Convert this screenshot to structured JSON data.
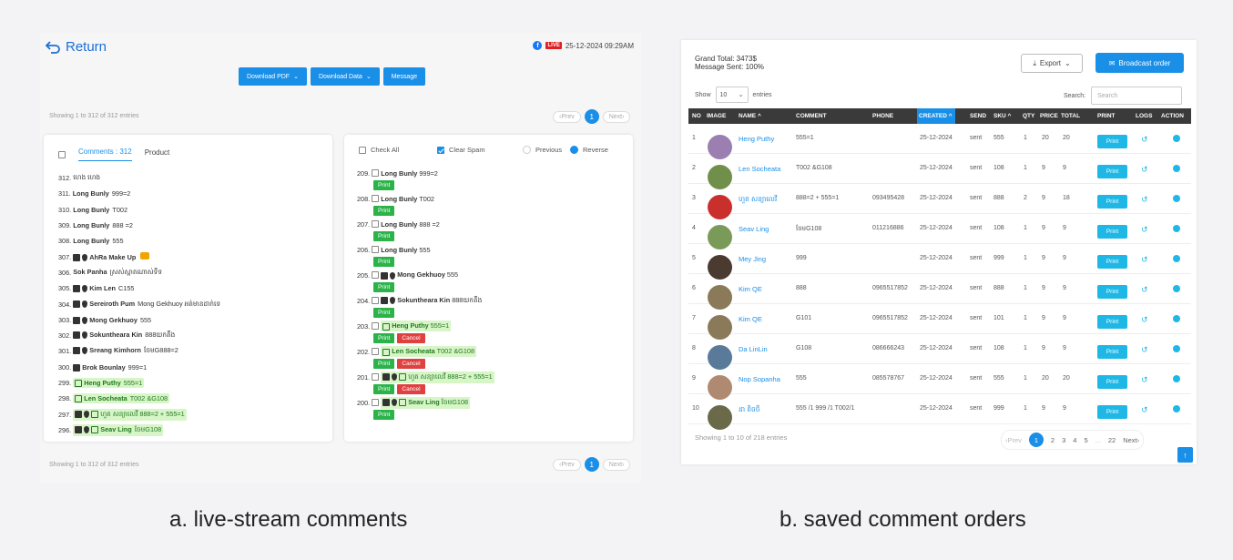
{
  "left": {
    "return_label": "Return",
    "live_badge": "LIVE",
    "timestamp": "25-12-2024 09:29AM",
    "buttons": {
      "pdf": "Download PDF",
      "data": "Download Data",
      "message": "Message"
    },
    "showing_top": "Showing 1 to 312 of 312 entries",
    "showing_bottom": "Showing 1 to 312 of 312 entries",
    "pager": {
      "prev": "‹Prev",
      "current": "1",
      "next": "Next›"
    },
    "tabs": {
      "comments": "Comments : 312",
      "product": "Product"
    },
    "comments": [
      {
        "num": "312.",
        "name": "",
        "text": "ហេង ហេង",
        "icons": [],
        "hl": false
      },
      {
        "num": "311.",
        "name": "Long Bunly",
        "text": "999=2",
        "icons": [],
        "hl": false
      },
      {
        "num": "310.",
        "name": "Long Bunly",
        "text": "T002",
        "icons": [],
        "hl": false
      },
      {
        "num": "309.",
        "name": "Long Bunly",
        "text": "888 =2",
        "icons": [],
        "hl": false
      },
      {
        "num": "308.",
        "name": "Long Bunly",
        "text": "555",
        "icons": [],
        "hl": false
      },
      {
        "num": "307.",
        "name": "AhRa Make Up",
        "text": "",
        "icons": [
          "msg",
          "pin"
        ],
        "hl": false,
        "emoji": true
      },
      {
        "num": "306.",
        "name": "Sok Panha",
        "text": "ស្រស់ស្អាតណាស់ទីទ",
        "icons": [],
        "hl": false
      },
      {
        "num": "305.",
        "name": "Kim Len",
        "text": "C155",
        "icons": [
          "msg",
          "pin"
        ],
        "hl": false
      },
      {
        "num": "304.",
        "name": "Sereiroth Pum",
        "text": "Mong Gekhuoy អត់មានដាក់ទេ",
        "icons": [
          "msg",
          "pin"
        ],
        "hl": false
      },
      {
        "num": "303.",
        "name": "Mong Gekhuoy",
        "text": "555",
        "icons": [
          "msg",
          "pin"
        ],
        "hl": false
      },
      {
        "num": "302.",
        "name": "Sokuntheara Kin",
        "text": "888យកតឹង",
        "icons": [
          "msg",
          "pin"
        ],
        "hl": false
      },
      {
        "num": "301.",
        "name": "Sreang Kimhorn",
        "text": "ចែមG888=2",
        "icons": [
          "msg",
          "pin"
        ],
        "hl": false
      },
      {
        "num": "300.",
        "name": "Brok Bounlay",
        "text": "999=1",
        "icons": [
          "msg"
        ],
        "hl": false
      },
      {
        "num": "299.",
        "name": "Heng Puthy",
        "text": "555=1",
        "icons": [
          "mail"
        ],
        "hl": true
      },
      {
        "num": "298.",
        "name": "Len Socheata",
        "text": "T002 &G108",
        "icons": [
          "mail"
        ],
        "hl": true
      },
      {
        "num": "297.",
        "name": "",
        "text": "ហួត សន្យាលេវី 888=2 + 555=1",
        "icons": [
          "msg",
          "pin",
          "mail"
        ],
        "hl": true
      },
      {
        "num": "296.",
        "name": "Seav Ling",
        "text": "ចែមG108",
        "icons": [
          "msg",
          "pin",
          "mail"
        ],
        "hl": true
      }
    ],
    "print_top": {
      "check_all": "Check All",
      "clear_spam": "Clear Spam",
      "previous": "Previous",
      "reverse": "Reverse"
    },
    "print_items": [
      {
        "num": "209.",
        "name": "Long Bunly",
        "text": "999=2",
        "icons": [],
        "hl": false,
        "cancel": false
      },
      {
        "num": "208.",
        "name": "Long Bunly",
        "text": "T002",
        "icons": [],
        "hl": false,
        "cancel": false
      },
      {
        "num": "207.",
        "name": "Long Bunly",
        "text": "888 =2",
        "icons": [],
        "hl": false,
        "cancel": false
      },
      {
        "num": "206.",
        "name": "Long Bunly",
        "text": "555",
        "icons": [],
        "hl": false,
        "cancel": false
      },
      {
        "num": "205.",
        "name": "Mong Gekhuoy",
        "text": "555",
        "icons": [
          "msg",
          "pin"
        ],
        "hl": false,
        "cancel": false
      },
      {
        "num": "204.",
        "name": "Sokuntheara Kin",
        "text": "888យកតឹង",
        "icons": [
          "msg",
          "pin"
        ],
        "hl": false,
        "cancel": false
      },
      {
        "num": "203.",
        "name": "Heng Puthy",
        "text": "555=1",
        "icons": [
          "mail"
        ],
        "hl": true,
        "cancel": true
      },
      {
        "num": "202.",
        "name": "Len Socheata",
        "text": "T002 &G108",
        "icons": [
          "mail"
        ],
        "hl": true,
        "cancel": true
      },
      {
        "num": "201.",
        "name": "",
        "text": "ហួត សន្យាលេវី 888=2 + 555=1",
        "icons": [
          "msg",
          "pin",
          "mail"
        ],
        "hl": true,
        "cancel": true
      },
      {
        "num": "200.",
        "name": "Seav Ling",
        "text": "ចែមG108",
        "icons": [
          "msg",
          "pin",
          "mail"
        ],
        "hl": true,
        "cancel": false
      }
    ],
    "print_label": "Print",
    "cancel_label": "Cancel",
    "caption": "a. live-stream comments"
  },
  "right": {
    "grand_total": "Grand Total: 3473$",
    "message_sent": "Message Sent: 100%",
    "export_label": "Export",
    "broadcast_label": "Broadcast order",
    "show_label": "Show",
    "show_value": "10",
    "entries_label": "entries",
    "search_label": "Search:",
    "search_placeholder": "Search",
    "headers": [
      "NO",
      "IMAGE",
      "NAME ^",
      "COMMENT",
      "PHONE",
      "CREATED ^",
      "SEND",
      "SKU ^",
      "QTY",
      "PRICE",
      "TOTAL",
      "PRINT",
      "LOGS",
      "ACTION"
    ],
    "rows": [
      {
        "no": "1",
        "name": "Heng Puthy",
        "comment": "555=1",
        "phone": "",
        "created": "25-12-2024",
        "send": "sent",
        "sku": "555",
        "qty": "1",
        "price": "20",
        "total": "20",
        "avatar": "#9a7fb0"
      },
      {
        "no": "2",
        "name": "Len Socheata",
        "comment": "T002 &G108",
        "phone": "",
        "created": "25-12-2024",
        "send": "sent",
        "sku": "108",
        "qty": "1",
        "price": "9",
        "total": "9",
        "avatar": "#6f8f4a"
      },
      {
        "no": "3",
        "name": "ហួត សន្យាលេវី",
        "comment": "888=2 + 555=1",
        "phone": "093495428",
        "created": "25-12-2024",
        "send": "sent",
        "sku": "888",
        "qty": "2",
        "price": "9",
        "total": "18",
        "avatar": "#c9302c"
      },
      {
        "no": "4",
        "name": "Seav Ling",
        "comment": "ចែមG108",
        "phone": "011216886",
        "created": "25-12-2024",
        "send": "sent",
        "sku": "108",
        "qty": "1",
        "price": "9",
        "total": "9",
        "avatar": "#7a9a5a"
      },
      {
        "no": "5",
        "name": "Mey Jing",
        "comment": "999",
        "phone": "",
        "created": "25-12-2024",
        "send": "sent",
        "sku": "999",
        "qty": "1",
        "price": "9",
        "total": "9",
        "avatar": "#4a3a30"
      },
      {
        "no": "6",
        "name": "Kim QE",
        "comment": "888",
        "phone": "0965517852",
        "created": "25-12-2024",
        "send": "sent",
        "sku": "888",
        "qty": "1",
        "price": "9",
        "total": "9",
        "avatar": "#8a7a5a"
      },
      {
        "no": "7",
        "name": "Kim QE",
        "comment": "G101",
        "phone": "0965517852",
        "created": "25-12-2024",
        "send": "sent",
        "sku": "101",
        "qty": "1",
        "price": "9",
        "total": "9",
        "avatar": "#8a7a5a"
      },
      {
        "no": "8",
        "name": "Da LinLin",
        "comment": "G108",
        "phone": "086666243",
        "created": "25-12-2024",
        "send": "sent",
        "sku": "108",
        "qty": "1",
        "price": "9",
        "total": "9",
        "avatar": "#5a7a9a"
      },
      {
        "no": "9",
        "name": "Nop Sopanha",
        "comment": "555",
        "phone": "085578767",
        "created": "25-12-2024",
        "send": "sent",
        "sku": "555",
        "qty": "1",
        "price": "20",
        "total": "20",
        "avatar": "#b08a70"
      },
      {
        "no": "10",
        "name": "ដា តិចចី",
        "comment": "555 /1 999 /1 T002/1",
        "phone": "",
        "created": "25-12-2024",
        "send": "sent",
        "sku": "999",
        "qty": "1",
        "price": "9",
        "total": "9",
        "avatar": "#6a6a4a"
      }
    ],
    "print_label": "Print",
    "showing": "Showing 1 to 10 of 218 entries",
    "pager": {
      "prev": "‹Prev",
      "pages": [
        "1",
        "2",
        "3",
        "4",
        "5",
        "...",
        "22"
      ],
      "next": "Next›"
    },
    "caption": "b. saved comment orders"
  },
  "colors": {
    "accent": "#1a8fe8",
    "highlight": "#d8f5c8",
    "print_green": "#2bb34a",
    "cancel_red": "#e04040"
  }
}
